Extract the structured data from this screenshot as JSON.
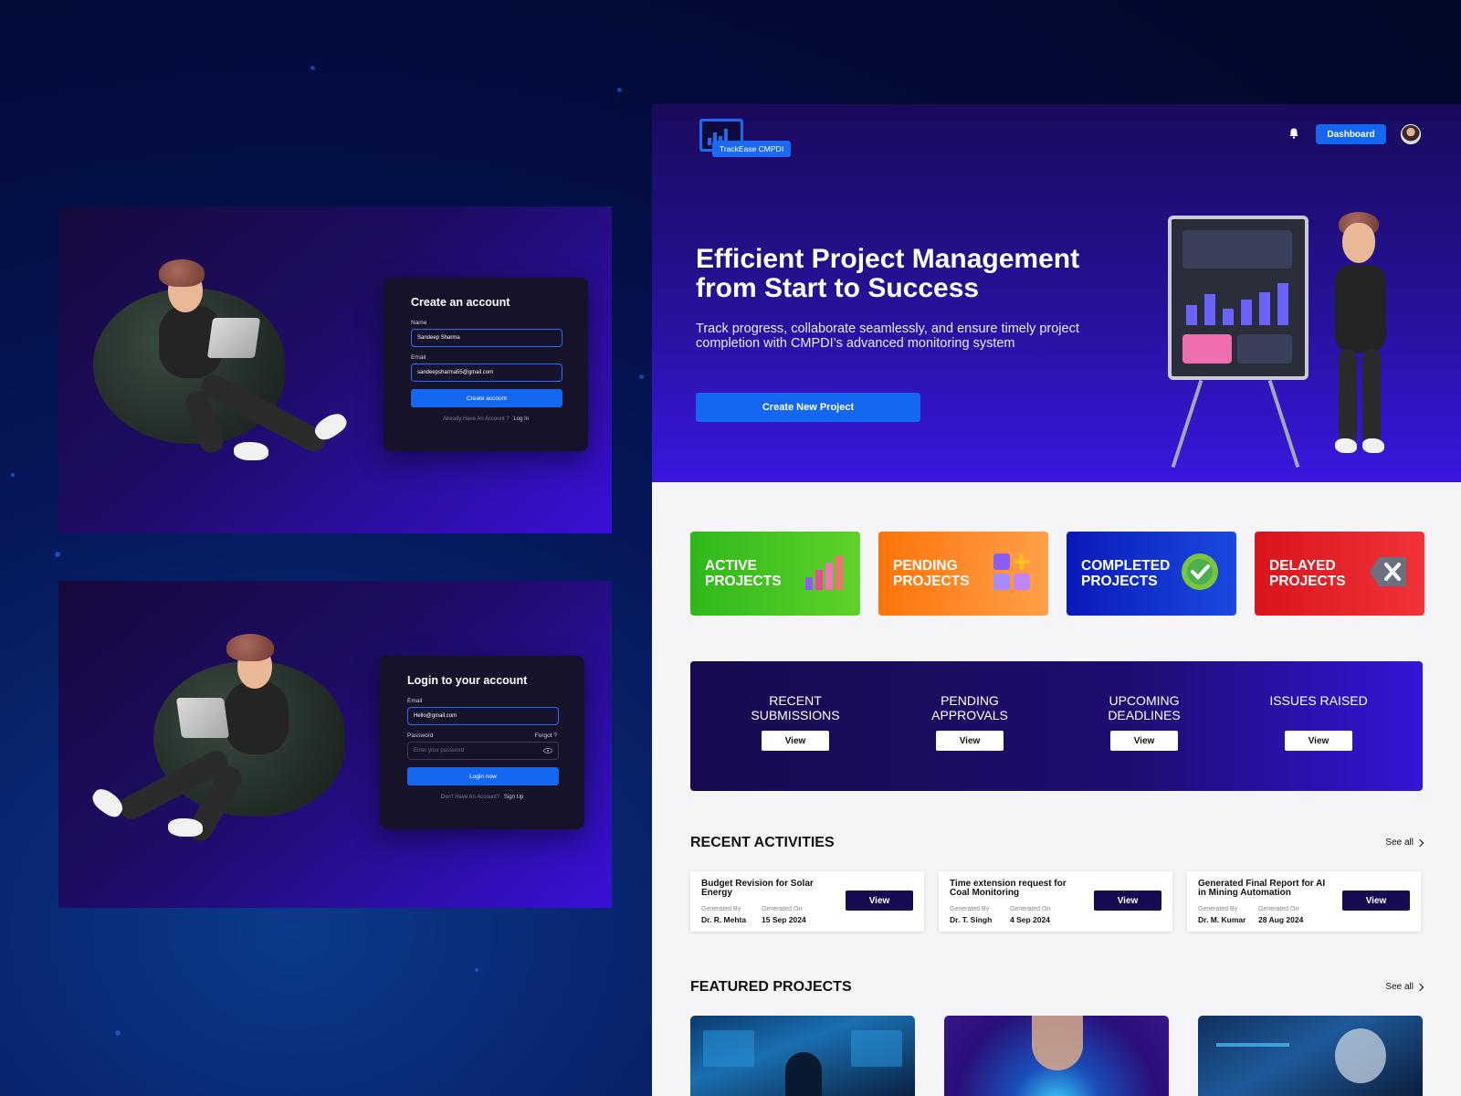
{
  "signup": {
    "title": "Create an account",
    "name_label": "Name",
    "name_value": "Sandeep Sharma",
    "email_label": "Email",
    "email_value": "sandeepsharma55@gmail.com",
    "submit_label": "Create account",
    "footer_text": "Already Have An Account ?",
    "footer_link": "Log In"
  },
  "login": {
    "title": "Login to your account",
    "email_label": "Email",
    "email_value": "Hello@gmail.com",
    "password_label": "Password",
    "forgot_label": "Forgot ?",
    "password_placeholder": "Enter your password",
    "submit_label": "Login now",
    "footer_text": "Don't Have An Account?",
    "footer_link": "Sign Up"
  },
  "header": {
    "logo_text": "TrackEase CMPDI",
    "dashboard_label": "Dashboard"
  },
  "hero": {
    "title": "Efficient Project Management from Start to Success",
    "subtitle": "Track progress, collaborate seamlessly, and ensure timely project completion with CMPDI’s advanced monitoring system",
    "cta_label": "Create New Project"
  },
  "stats": [
    {
      "label": "ACTIVE PROJECTS",
      "color": "#3fc01c"
    },
    {
      "label": "PENDING PROJECTS",
      "color": "#ff7a12"
    },
    {
      "label": "COMPLETED PROJECTS",
      "color": "#0b24c9"
    },
    {
      "label": "DELAYED PROJECTS",
      "color": "#e01b20"
    }
  ],
  "quick_links": [
    {
      "label": "RECENT SUBMISSIONS",
      "button": "View"
    },
    {
      "label": "PENDING APPROVALS",
      "button": "View"
    },
    {
      "label": "UPCOMING DEADLINES",
      "button": "View"
    },
    {
      "label": "ISSUES RAISED",
      "button": "View"
    }
  ],
  "recent_activities": {
    "title": "RECENT ACTIVITIES",
    "see_all": "See all",
    "items": [
      {
        "title": "Budget Revision for Solar Energy",
        "gen_by_label": "Generated By",
        "gen_by": "Dr. R. Mehta",
        "gen_on_label": "Generated On",
        "gen_on": "15 Sep 2024",
        "button": "View"
      },
      {
        "title": "Time extension request for Coal Monitoring",
        "gen_by_label": "Generated By",
        "gen_by": "Dr. T. Singh",
        "gen_on_label": "Generated On",
        "gen_on": "4 Sep 2024",
        "button": "View"
      },
      {
        "title": "Generated Final Report for AI in Mining Automation",
        "gen_by_label": "Generated By",
        "gen_by": "Dr. M. Kumar",
        "gen_on_label": "Generated On",
        "gen_on": "28 Aug 2024",
        "button": "View"
      }
    ]
  },
  "featured_projects": {
    "title": "FEATURED PROJECTS",
    "see_all": "See all"
  },
  "colors": {
    "accent": "#1467f0",
    "dark_navy": "#160c54"
  }
}
